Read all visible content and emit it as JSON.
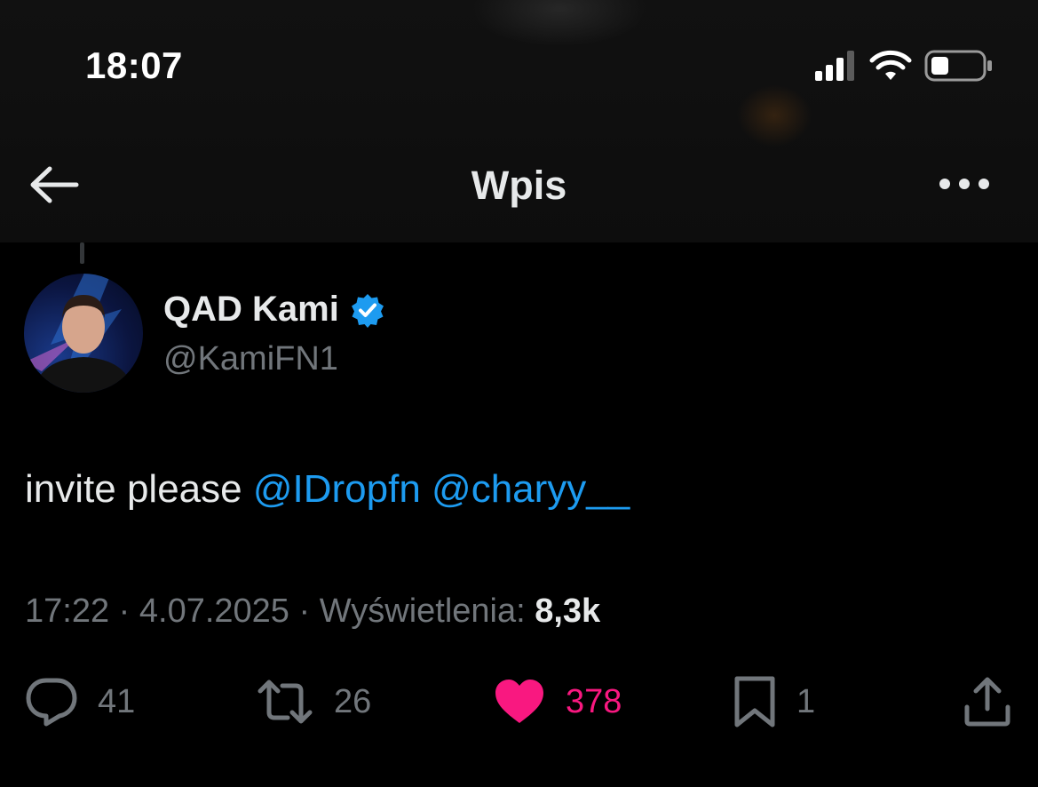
{
  "status_bar": {
    "time": "18:07",
    "icons": [
      "signal-icon",
      "wifi-icon",
      "battery-icon"
    ],
    "battery_level": 0.3
  },
  "nav": {
    "title": "Wpis",
    "back_icon": "arrow-left-icon",
    "more_icon": "more-horizontal-icon"
  },
  "tweet": {
    "author": {
      "name": "QAD Kami",
      "handle": "@KamiFN1",
      "verified": true
    },
    "text_prefix": "invite please",
    "mentions": [
      "@IDropfn",
      "@charyy__"
    ],
    "time": "17:22",
    "date": "4.07.2025",
    "views_label": "Wyświetlenia:",
    "views_value": "8,3k",
    "separator": "·"
  },
  "actions": {
    "replies": "41",
    "retweets": "26",
    "likes": "378",
    "bookmarks": "1"
  },
  "colors": {
    "background": "#000000",
    "text": "#e7e9ea",
    "muted": "#71767b",
    "link": "#1d9bf0",
    "like": "#f91880",
    "verified": "#1d9bf0"
  }
}
